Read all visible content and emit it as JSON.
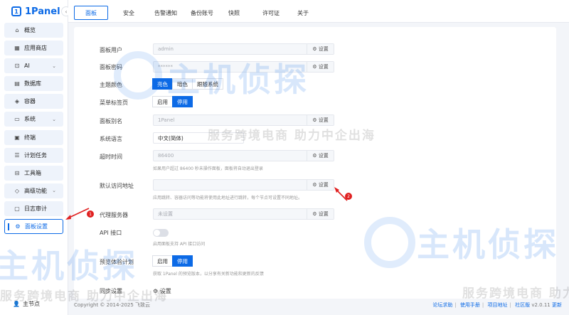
{
  "app": {
    "logo": "1Panel"
  },
  "sidebar": {
    "items": [
      {
        "label": "概览",
        "icon": "home-icon"
      },
      {
        "label": "应用商店",
        "icon": "grid-icon"
      },
      {
        "label": "AI",
        "icon": "robot-icon"
      },
      {
        "label": "数据库",
        "icon": "database-icon"
      },
      {
        "label": "容器",
        "icon": "container-icon"
      },
      {
        "label": "系统",
        "icon": "folder-icon"
      },
      {
        "label": "终端",
        "icon": "terminal-icon"
      },
      {
        "label": "计划任务",
        "icon": "list-icon"
      },
      {
        "label": "工具箱",
        "icon": "toolbox-icon"
      },
      {
        "label": "高级功能",
        "icon": "diamond-icon"
      },
      {
        "label": "日志审计",
        "icon": "log-icon"
      },
      {
        "label": "面板设置",
        "icon": "gear-icon"
      }
    ],
    "node": "主节点"
  },
  "tabs": [
    "面板",
    "安全",
    "告警通知",
    "备份账号",
    "快照",
    "许可证",
    "关于"
  ],
  "settings": {
    "panel_user": {
      "label": "面板用户",
      "value": "admin",
      "button": "设置"
    },
    "panel_password": {
      "label": "面板密码",
      "value": "******",
      "button": "设置"
    },
    "theme": {
      "label": "主题颜色",
      "options": [
        "亮色",
        "暗色",
        "跟随系统"
      ]
    },
    "menu_tab": {
      "label": "菜单标签页",
      "options": [
        "启用",
        "停用"
      ]
    },
    "panel_alias": {
      "label": "面板别名",
      "value": "1Panel",
      "button": "设置"
    },
    "language": {
      "label": "系统语言",
      "value": "中文(简体)"
    },
    "timeout": {
      "label": "超时时间",
      "value": "86400",
      "button": "设置",
      "hint": "如果用户超过 86400 秒未操作面板，面板将自动退出登录"
    },
    "default_url": {
      "label": "默认访问地址",
      "value": "",
      "button": "设置",
      "hint": "应用跳转、容器访问等功能将使用此地址进行跳转，每个节点可设置不同地址。"
    },
    "proxy": {
      "label": "代理服务器",
      "value": "未设置",
      "button": "设置"
    },
    "api": {
      "label": "API 接口",
      "hint": "启用面板支持 API 接口访问"
    },
    "preview": {
      "label": "预览体验计划",
      "options": [
        "启用",
        "停用"
      ],
      "hint": "获取 1Panel 的预览版本，以分享有关新功能和更新的反馈"
    },
    "sync_time": {
      "label": "同步设置",
      "button": "设置"
    }
  },
  "footer": {
    "copyright": "Copyright © 2014-2025 飞致云",
    "links": [
      "论坛求助",
      "使用手册",
      "项目地址",
      "社区版"
    ],
    "version": "v2.0.11",
    "update": "更新"
  },
  "annotations": {
    "badge1": "1",
    "badge2": "2"
  },
  "watermark": {
    "brand": "主机侦探",
    "slogan": "服务跨境电商 助力中企出海"
  },
  "colors": {
    "accent": "#0c6ae6",
    "annotation": "#e02020"
  }
}
